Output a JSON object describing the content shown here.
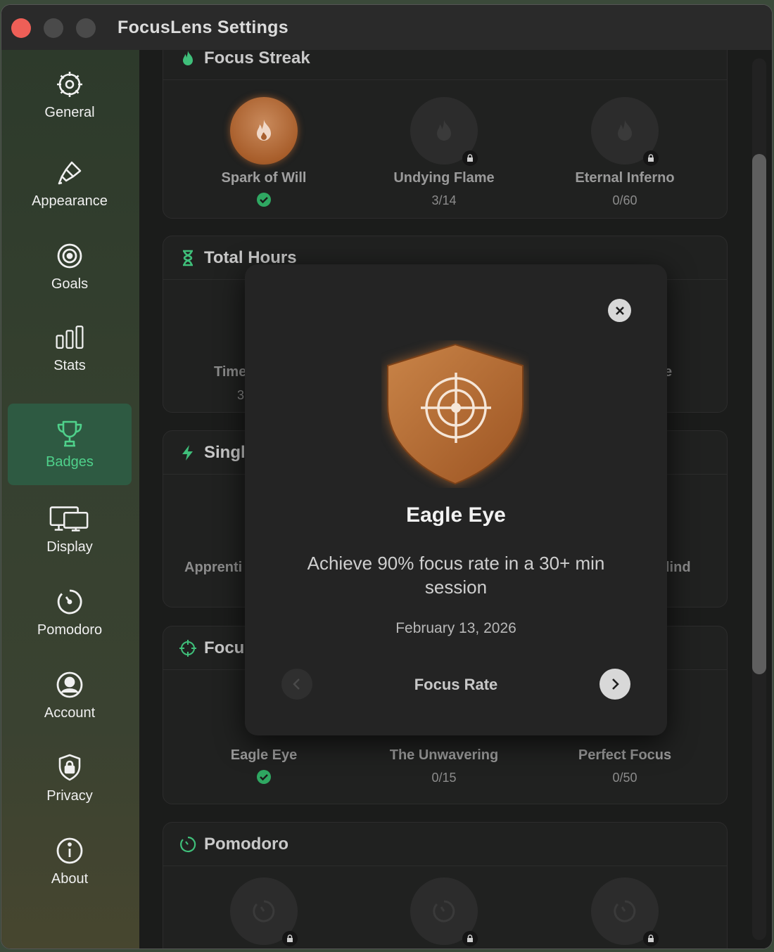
{
  "window": {
    "title": "FocusLens Settings"
  },
  "sidebar": {
    "items": [
      {
        "label": "General",
        "icon": "gear-icon"
      },
      {
        "label": "Appearance",
        "icon": "paintbrush-icon"
      },
      {
        "label": "Goals",
        "icon": "target-icon"
      },
      {
        "label": "Stats",
        "icon": "bar-chart-icon"
      },
      {
        "label": "Badges",
        "icon": "trophy-icon",
        "active": true
      },
      {
        "label": "Display",
        "icon": "display-icon"
      },
      {
        "label": "Pomodoro",
        "icon": "timer-icon"
      },
      {
        "label": "Account",
        "icon": "person-icon"
      },
      {
        "label": "Privacy",
        "icon": "shield-lock-icon"
      },
      {
        "label": "About",
        "icon": "info-icon"
      }
    ]
  },
  "sections": {
    "focus_streak": {
      "title": "Focus Streak",
      "badges": [
        {
          "name": "Spark of Will",
          "earned": true
        },
        {
          "name": "Undying Flame",
          "progress": "3/14"
        },
        {
          "name": "Eternal Inferno",
          "progress": "0/60"
        }
      ]
    },
    "total_hours": {
      "title": "Total Hours",
      "partial_left": "Time",
      "partial_left_sub": "3",
      "partial_right": "e"
    },
    "single": {
      "title": "Singl",
      "partial_left": "Apprenti",
      "partial_right": "lind"
    },
    "focus_rate": {
      "title": "Focu",
      "badges": [
        {
          "name": "Eagle Eye",
          "earned": true
        },
        {
          "name": "The Unwavering",
          "progress": "0/15"
        },
        {
          "name": "Perfect Focus",
          "progress": "0/50"
        }
      ]
    },
    "pomodoro": {
      "title": "Pomodoro"
    }
  },
  "modal": {
    "title": "Eagle Eye",
    "description": "Achieve 90% focus rate in a 30+ min session",
    "date": "February 13, 2026",
    "category": "Focus Rate"
  },
  "colors": {
    "accent": "#4fd18b",
    "bronze": "#b86f35",
    "close": "#ee5f57"
  }
}
